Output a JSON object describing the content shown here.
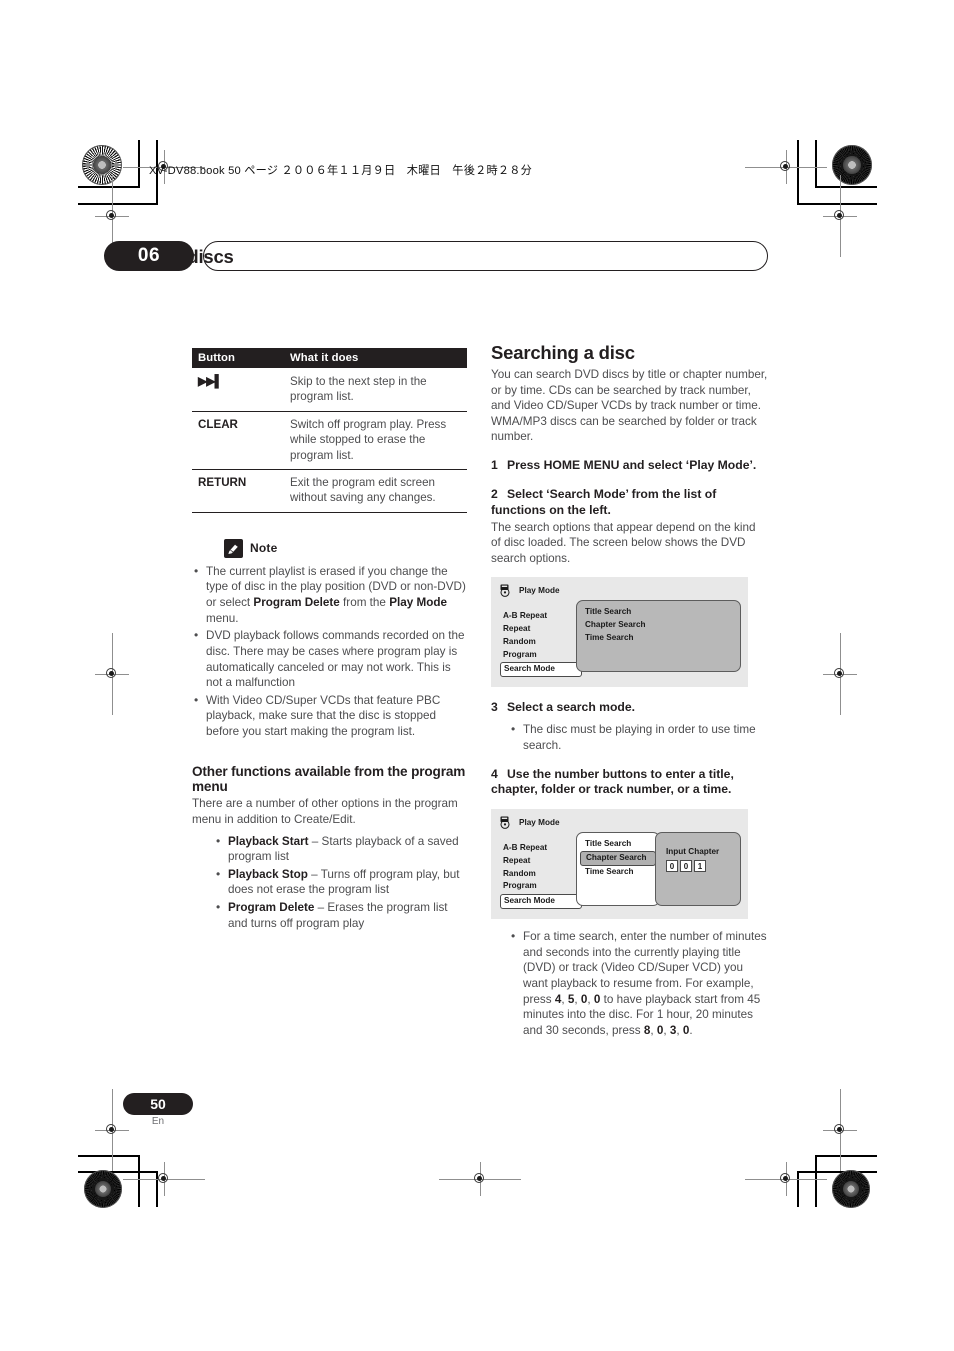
{
  "page": {
    "book_line": "XV-DV88.book  50 ページ  ２００６年１１月９日　木曜日　午後２時２８分",
    "chapter_number": "06",
    "chapter_title": "Playing discs",
    "page_number": "50",
    "page_language": "En"
  },
  "button_table": {
    "headers": [
      "Button",
      "What it does"
    ],
    "rows": [
      {
        "button": "▶▶▌",
        "button_is_icon": true,
        "icon_name": "skip-forward-icon",
        "description": "Skip to the next step in the program list."
      },
      {
        "button": "CLEAR",
        "button_is_icon": false,
        "description": "Switch off program play. Press while stopped to erase the program list."
      },
      {
        "button": "RETURN",
        "button_is_icon": false,
        "description": "Exit the program edit screen without saving any changes."
      }
    ]
  },
  "note": {
    "label": "Note",
    "icon": "pencil-note-icon",
    "items": [
      "The current playlist is erased if you change the type of disc in the play position (DVD or non-DVD) or select <b>Program Delete</b> from the <b>Play Mode</b> menu.",
      "DVD playback follows commands recorded on the disc. There may be cases where program play is automatically canceled or may not work. This is not a malfunction",
      "With Video CD/Super VCDs that feature PBC playback, make sure that the disc is stopped before you start making the program list."
    ]
  },
  "other_functions": {
    "heading": "Other functions available from the program menu",
    "intro": "There are a number of other options in the program menu in addition to Create/Edit.",
    "items": [
      "<b>Playback Start</b> – Starts playback of a saved program list",
      "<b>Playback Stop</b> – Turns off program play, but does not erase the program list",
      "<b>Program Delete</b> – Erases the program list and turns off program play"
    ]
  },
  "searching": {
    "heading": "Searching a disc",
    "intro": "You can search DVD discs by title or chapter number, or by time. CDs can be searched by track number, and Video CD/Super VCDs by track number or time. WMA/MP3 discs can be searched by folder or track number.",
    "step1_num": "1",
    "step1": "Press HOME MENU and select ‘Play Mode’.",
    "step2_num": "2",
    "step2": "Select ‘Search Mode’ from the list of functions on the left.",
    "step2_body": "The search options that appear depend on the kind of disc loaded. The screen below shows the DVD search options.",
    "step3_num": "3",
    "step3": "Select a search mode.",
    "step3_bullets": [
      "The disc must be playing in order to use time search."
    ],
    "step4_num": "4",
    "step4": "Use the number buttons to enter a title, chapter, folder or track number, or a time.",
    "step4_bullets": [
      "For a time search, enter the number of minutes and seconds into the currently playing title (DVD) or track (Video CD/Super VCD) you want playback to resume from. For example, press <b>4</b>, <b>5</b>, <b>0</b>, <b>0</b> to have playback start from 45 minutes into the disc. For 1 hour, 20 minutes and 30 seconds, press <b>8</b>, <b>0</b>, <b>3</b>, <b>0</b>."
    ]
  },
  "osd1": {
    "title": "Play Mode",
    "icon": "disc-player-icon",
    "menu": [
      "A-B Repeat",
      "Repeat",
      "Random",
      "Program",
      "Search Mode"
    ],
    "menu_selected": "Search Mode",
    "options": [
      "Title Search",
      "Chapter Search",
      "Time Search"
    ],
    "option_selected": null
  },
  "osd2": {
    "title": "Play Mode",
    "icon": "disc-player-icon",
    "menu": [
      "A-B Repeat",
      "Repeat",
      "Random",
      "Program",
      "Search Mode"
    ],
    "menu_selected": "Search Mode",
    "options": [
      "Title Search",
      "Chapter Search",
      "Time Search"
    ],
    "option_selected": "Chapter Search",
    "input_label": "Input Chapter",
    "input_digits": [
      "0",
      "0",
      "1"
    ]
  },
  "colors": {
    "ink": "#231f20",
    "body_text": "#4d4d4f",
    "osd_background": "#e8e8e8",
    "osd_panel_gray": "#b8b8b8"
  }
}
